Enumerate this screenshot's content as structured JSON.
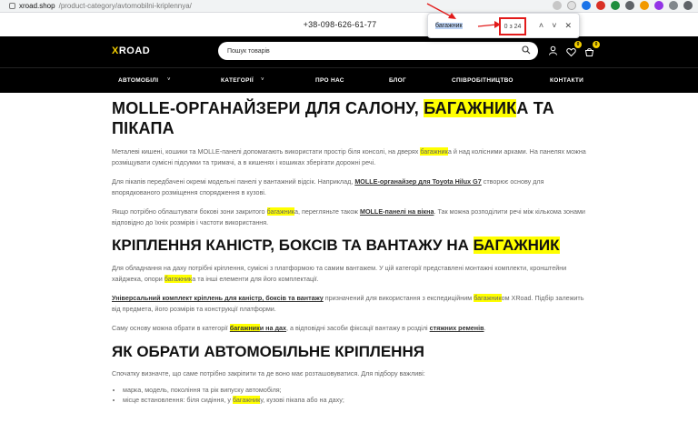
{
  "browser": {
    "url_host": "xroad.shop",
    "url_path": "/product-category/avtomobilni-kriplennya/"
  },
  "find_bar": {
    "query": "багажник",
    "count": "0 з 24",
    "up": "˄",
    "down": "˅",
    "close": "✕"
  },
  "header": {
    "phone": "+38-098-626-61-77",
    "logo_accent": "X",
    "logo_rest": "ROAD",
    "search_placeholder": "Пошук товарів",
    "wishlist_count": "0",
    "cart_count": "0"
  },
  "nav": {
    "items": [
      "АВТОМОБІЛІ",
      "КАТЕГОРІЇ",
      "ПРО НАС",
      "БЛОГ",
      "СПІВРОБІТНИЦТВО",
      "КОНТАКТИ"
    ],
    "chevron": "˅"
  },
  "content": {
    "h1_a": "MOLLE-ОРГАНАЙЗЕРИ ДЛЯ САЛОНУ, ",
    "h1_hl": "БАГАЖНИК",
    "h1_b": "А ТА ПІКАПА",
    "p1_a": "Металеві кишені, кошики та MOLLE-панелі допомагають використати простір біля консолі, на дверях ",
    "p1_hl": "багажник",
    "p1_b": "а й над колісними арками. На панелях можна розміщувати сумісні підсумки та тримачі, а в кишенях і кошиках зберігати дорожні речі.",
    "p2_a": "Для пікапів передбачені окремі модельні панелі у вантажний відсік. Наприклад, ",
    "p2_link": "MOLLE-органайзер для Toyota Hilux G7",
    "p2_b": " створює основу для впорядкованого розміщення спорядження в кузові.",
    "p3_a": "Якщо потрібно облаштувати бокові зони закритого ",
    "p3_hl": "багажник",
    "p3_b": "а, перегляньте також ",
    "p3_link": "MOLLE-панелі на вікна",
    "p3_c": ". Так можна розподілити речі між кількома зонами відповідно до їхніх розмірів і частоти використання.",
    "h2a_a": "КРІПЛЕННЯ КАНІСТР, БОКСІВ ТА ВАНТАЖУ НА ",
    "h2a_hl": "БАГАЖНИК",
    "p4_a": "Для обладнання на даху потрібні кріплення, сумісні з платформою та самим вантажем. У цій категорії представлені монтажні комплекти, кронштейни хайджека, опори ",
    "p4_hl": "багажник",
    "p4_b": "а та інші елементи для його комплектації.",
    "p5_link": "Універсальний комплект кріплень для каністр, боксів та вантажу",
    "p5_a": " призначений для використання з експедиційним ",
    "p5_hl": "багажник",
    "p5_b": "ом XRoad. Підбір залежить від предмета, його розмірів та конструкції платформи.",
    "p6_a": "Саму основу можна обрати в категорії ",
    "p6_link_hl": "багажник",
    "p6_link_rest": "и на дах",
    "p6_b": ", а відповідні засоби фіксації вантажу в розділі ",
    "p6_link2": "стяжних ременів",
    "p6_c": ".",
    "h2b": "ЯК ОБРАТИ АВТОМОБІЛЬНЕ КРІПЛЕННЯ",
    "p7": "Спочатку визначте, що саме потрібно закріпити та де воно має розташовуватися. Для підбору важливі:",
    "li1": "марка, модель, покоління та рік випуску автомобіля;",
    "li2_a": "місце встановлення: біля сидіння, у ",
    "li2_hl": "багажник",
    "li2_b": "у, кузові пікапа або на даху;"
  },
  "colors": {
    "accent": "#f5d000",
    "highlight": "#ffff00",
    "header_bg": "#000000",
    "annotation": "#e21b1b"
  }
}
